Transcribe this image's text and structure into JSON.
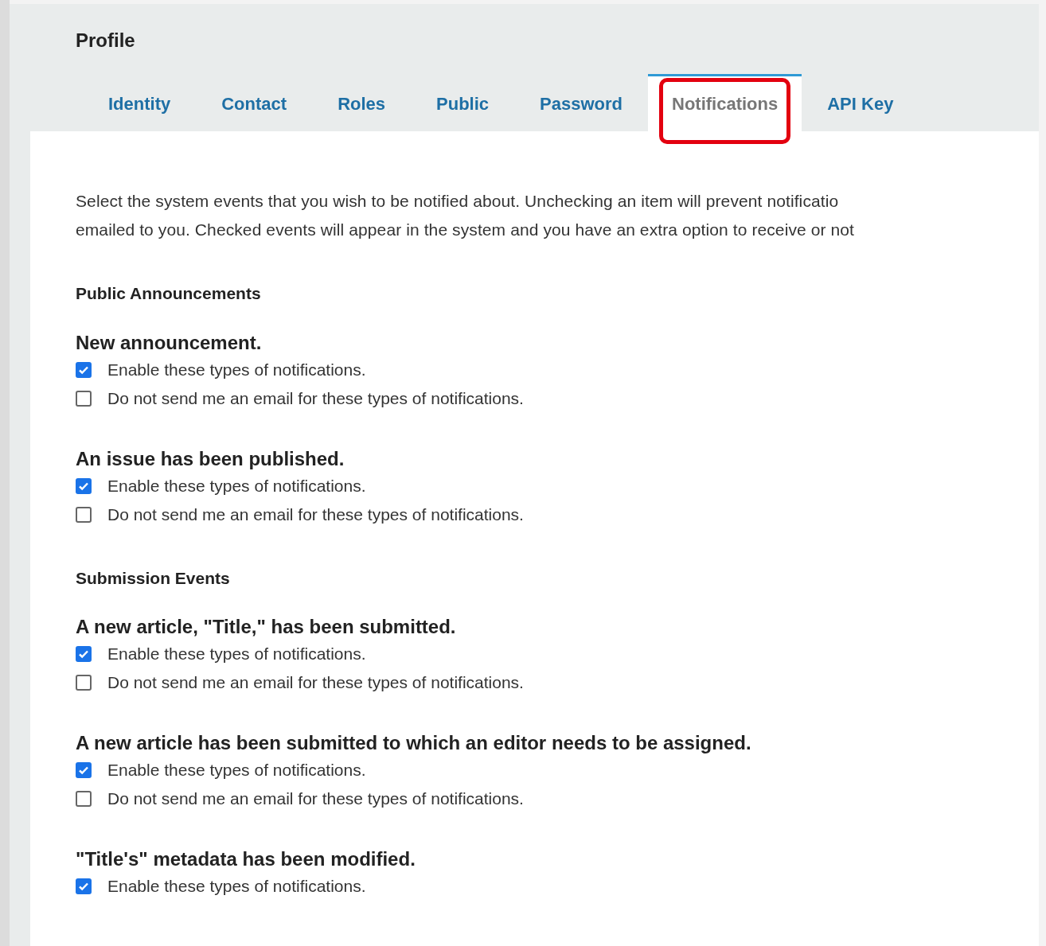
{
  "title": "Profile",
  "tabs": [
    {
      "label": "Identity",
      "selected": false
    },
    {
      "label": "Contact",
      "selected": false
    },
    {
      "label": "Roles",
      "selected": false
    },
    {
      "label": "Public",
      "selected": false
    },
    {
      "label": "Password",
      "selected": false
    },
    {
      "label": "Notifications",
      "selected": true
    },
    {
      "label": "API Key",
      "selected": false
    }
  ],
  "intro_lines": [
    "Select the system events that you wish to be notified about. Unchecking an item will prevent notificatio",
    "emailed to you. Checked events will appear in the system and you have an extra option to receive or not"
  ],
  "sections": [
    {
      "heading": "Public Announcements",
      "events": [
        {
          "title": "New announcement.",
          "options": [
            {
              "label": "Enable these types of notifications.",
              "checked": true
            },
            {
              "label": "Do not send me an email for these types of notifications.",
              "checked": false
            }
          ]
        },
        {
          "title": "An issue has been published.",
          "options": [
            {
              "label": "Enable these types of notifications.",
              "checked": true
            },
            {
              "label": "Do not send me an email for these types of notifications.",
              "checked": false
            }
          ]
        }
      ]
    },
    {
      "heading": "Submission Events",
      "events": [
        {
          "title": "A new article, \"Title,\" has been submitted.",
          "options": [
            {
              "label": "Enable these types of notifications.",
              "checked": true
            },
            {
              "label": "Do not send me an email for these types of notifications.",
              "checked": false
            }
          ]
        },
        {
          "title": "A new article has been submitted to which an editor needs to be assigned.",
          "options": [
            {
              "label": "Enable these types of notifications.",
              "checked": true
            },
            {
              "label": "Do not send me an email for these types of notifications.",
              "checked": false
            }
          ]
        },
        {
          "title": "\"Title's\" metadata has been modified.",
          "options": [
            {
              "label": "Enable these types of notifications.",
              "checked": true
            }
          ]
        }
      ]
    }
  ]
}
